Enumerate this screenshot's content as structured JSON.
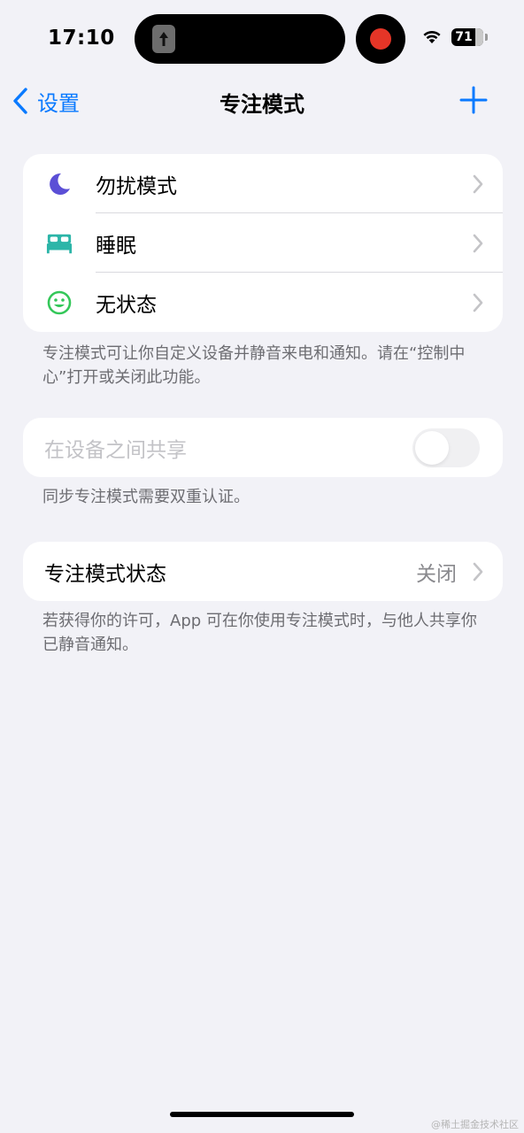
{
  "status_bar": {
    "time": "17:10",
    "battery": "71",
    "recording_color": "#e53527"
  },
  "nav": {
    "back_label": "设置",
    "title": "专注模式",
    "accent_color": "#0a7aff"
  },
  "focus_modes": [
    {
      "label": "勿扰模式",
      "icon": "moon-icon",
      "color": "#5b4fd6"
    },
    {
      "label": "睡眠",
      "icon": "bed-icon",
      "color": "#2cb5a8"
    },
    {
      "label": "无状态",
      "icon": "smiley-icon",
      "color": "#34c759"
    }
  ],
  "focus_footer": "专注模式可让你自定义设备并静音来电和通知。请在“控制中心”打开或关闭此功能。",
  "share_across": {
    "label": "在设备之间共享",
    "enabled": false,
    "footer": "同步专注模式需要双重认证。"
  },
  "focus_status": {
    "label": "专注模式状态",
    "value": "关闭",
    "footer": "若获得你的许可，App 可在你使用专注模式时，与他人共享你已静音通知。"
  },
  "watermark": "@稀土掘金技术社区"
}
